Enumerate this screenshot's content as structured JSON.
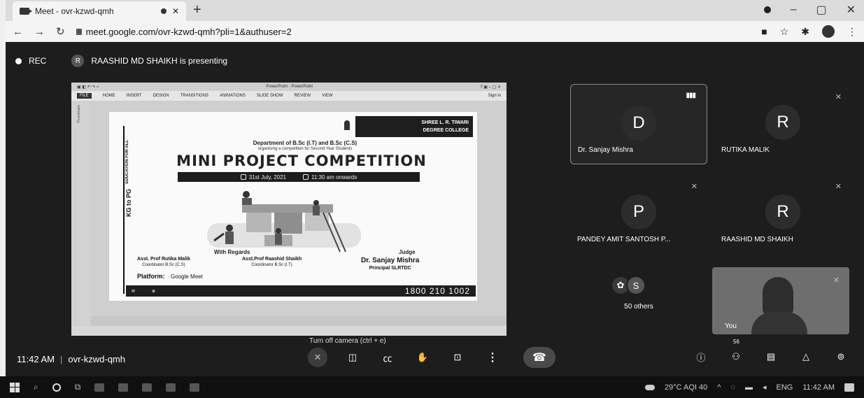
{
  "browser": {
    "tab_title": "Meet - ovr-kzwd-qmh",
    "url": "meet.google.com/ovr-kzwd-qmh?pli=1&authuser=2",
    "new_tab_icon": "plus-icon",
    "close_tab_icon": "close-icon"
  },
  "meet": {
    "rec_label": "REC",
    "presenter_initial": "R",
    "presenter_text": "RAASHID MD SHAIKH is presenting"
  },
  "ppt": {
    "window_title": "PowerPoint - PowerPoint",
    "ribbon_tabs": [
      "FILE",
      "HOME",
      "INSERT",
      "DESIGN",
      "TRANSITIONS",
      "ANIMATIONS",
      "SLIDE SHOW",
      "REVIEW",
      "VIEW"
    ],
    "sign_in": "Sign in",
    "thumbnails_label": "Thumbnails"
  },
  "slide": {
    "college_name_1": "SHREE L. R. TIWARI",
    "college_name_2": "DEGREE COLLEGE",
    "side_text_1": "EDUCATION FOR ALL",
    "side_text_2": "KG to PG",
    "department": "Department of B.Sc (I.T) and B.Sc (C.S)",
    "organising": "organising a competition for Second Year Students",
    "title": "MINI PROJECT COMPETITION",
    "date": "31st July, 2021",
    "time": "11:30 am onwards",
    "regards": "With Regards",
    "judge_label": "Judge",
    "coord1_name": "Asst. Prof Rutika Malik",
    "coord1_role": "Coordinator B.Sc (C.S)",
    "coord2_name": "Asst.Prof Raashid Shaikh",
    "coord2_role": "Coordinator B.Sc (I.T)",
    "judge_name": "Dr. Sanjay Mishra",
    "judge_role": "Principal SLRTDC",
    "platform_label": "Platform:",
    "platform_value": "Google Meet",
    "phone": "1800 210 1002"
  },
  "participants": [
    {
      "initial": "D",
      "name": "Dr. Sanjay Mishra"
    },
    {
      "initial": "R",
      "name": "RUTIKA MALIK"
    },
    {
      "initial": "P",
      "name": "PANDEY AMIT SANTOSH P..."
    },
    {
      "initial": "R",
      "name": "RAASHID MD SHAIKH"
    }
  ],
  "others": {
    "initial": "S",
    "label": "50 others"
  },
  "self_tile": {
    "name": "You"
  },
  "controls": {
    "tooltip": "Turn off camera (ctrl + e)",
    "time": "11:42 AM",
    "meeting_code": "ovr-kzwd-qmh",
    "participant_count": "56"
  },
  "taskbar": {
    "weather": "29°C AQI 40",
    "lang": "ENG",
    "clock": "11:42 AM"
  }
}
